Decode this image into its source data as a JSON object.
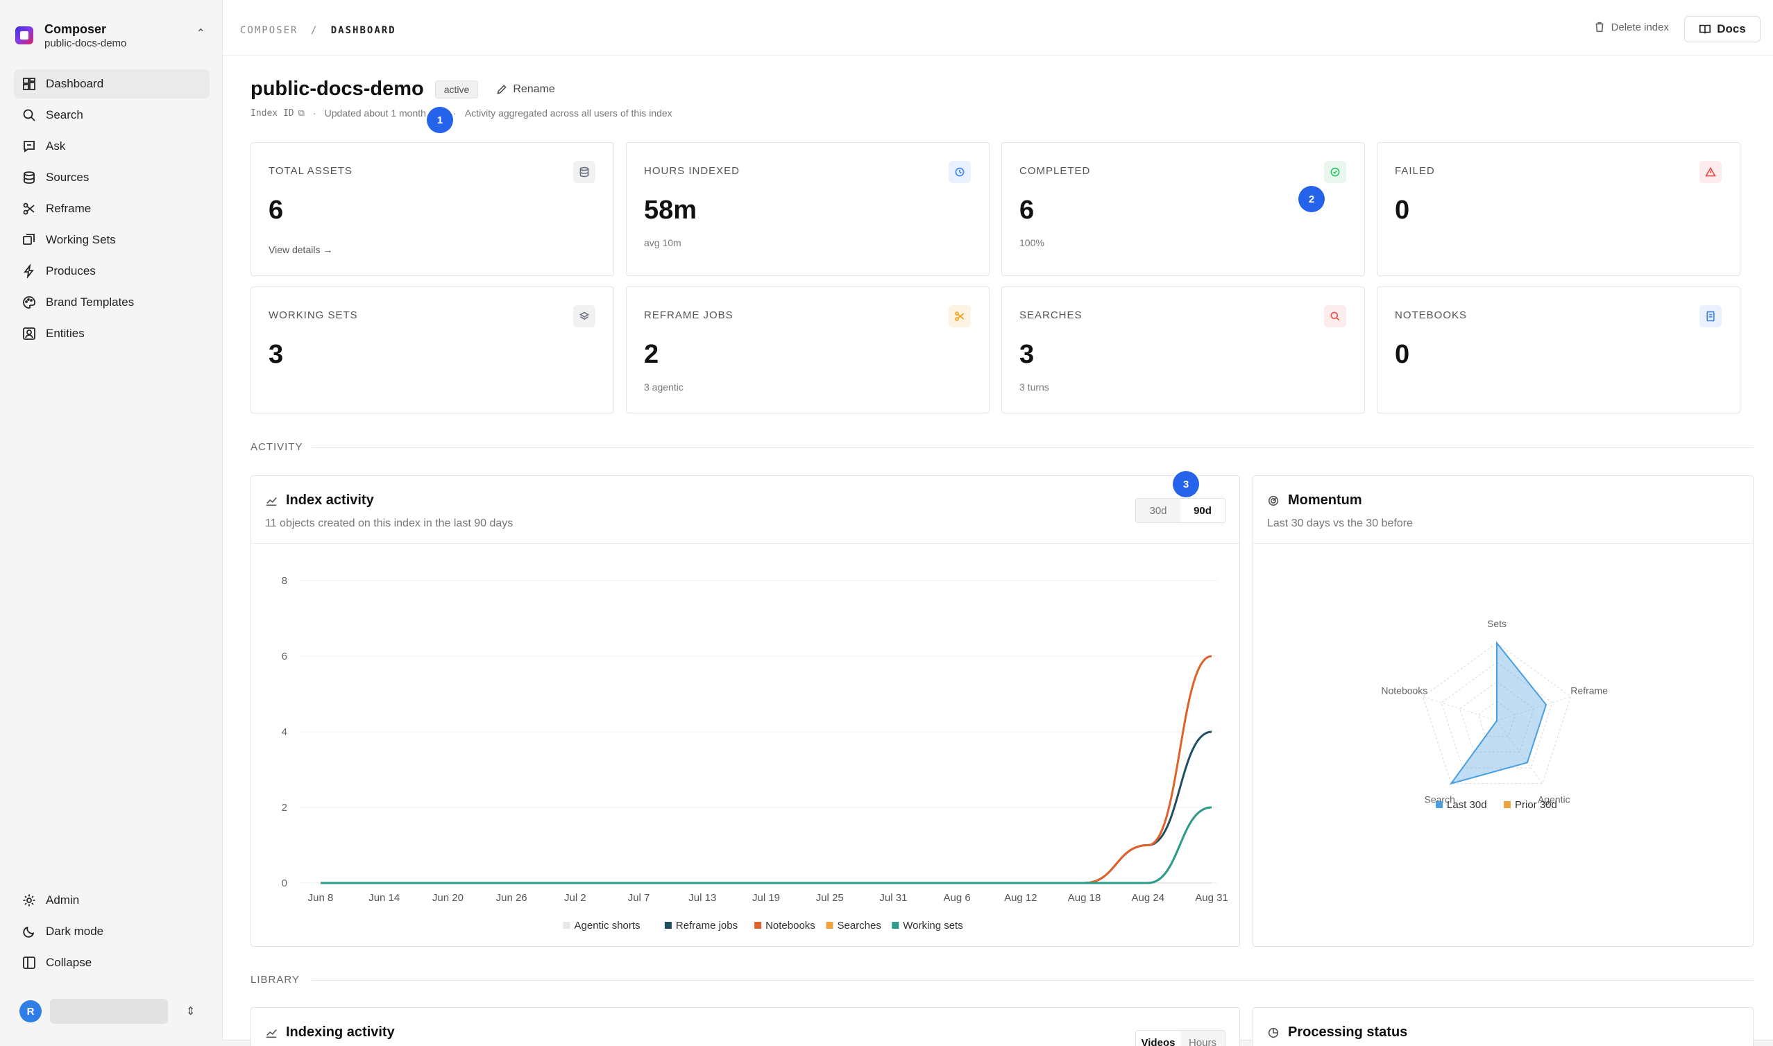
{
  "sidebar": {
    "workspace_name": "Composer",
    "workspace_index": "public-docs-demo",
    "nav": [
      {
        "label": "Dashboard",
        "icon": "dashboard-icon"
      },
      {
        "label": "Search",
        "icon": "search-icon"
      },
      {
        "label": "Ask",
        "icon": "chat-icon"
      },
      {
        "label": "Sources",
        "icon": "database-icon"
      },
      {
        "label": "Reframe",
        "icon": "scissors-icon"
      },
      {
        "label": "Working Sets",
        "icon": "layers-icon"
      },
      {
        "label": "Produces",
        "icon": "bolt-icon"
      },
      {
        "label": "Brand Templates",
        "icon": "palette-icon"
      },
      {
        "label": "Entities",
        "icon": "entity-icon"
      }
    ],
    "bottom": [
      {
        "label": "Admin",
        "icon": "gear-icon"
      },
      {
        "label": "Dark mode",
        "icon": "moon-icon"
      },
      {
        "label": "Collapse",
        "icon": "collapse-icon"
      }
    ],
    "user_initial": "R"
  },
  "topbar": {
    "crumb_root": "COMPOSER",
    "crumb_sep": "/",
    "crumb_current": "DASHBOARD",
    "delete_label": "Delete index",
    "docs_label": "Docs"
  },
  "header": {
    "title": "public-docs-demo",
    "status": "active",
    "rename_label": "Rename",
    "index_id_label": "Index ID",
    "updated": "Updated about 1 month ago",
    "note": "Activity aggregated across all users of this index"
  },
  "markers": [
    "1",
    "2",
    "3"
  ],
  "stats": [
    {
      "label": "TOTAL ASSETS",
      "value": "6",
      "sub": "View details →",
      "icon": "database-icon",
      "color": "#6b7280"
    },
    {
      "label": "HOURS INDEXED",
      "value": "58m",
      "sub": "avg 10m",
      "icon": "clock-icon",
      "color": "#3b82f6"
    },
    {
      "label": "COMPLETED",
      "value": "6",
      "sub": "100%",
      "icon": "check-circle-icon",
      "color": "#22c55e"
    },
    {
      "label": "FAILED",
      "value": "0",
      "sub": "",
      "icon": "warning-icon",
      "color": "#ef4444"
    },
    {
      "label": "WORKING SETS",
      "value": "3",
      "sub": "",
      "icon": "layers-icon",
      "color": "#6b7280"
    },
    {
      "label": "REFRAME JOBS",
      "value": "2",
      "sub": "3 agentic",
      "icon": "scissors-icon",
      "color": "#f59e0b"
    },
    {
      "label": "SEARCHES",
      "value": "3",
      "sub": "3 turns",
      "icon": "search-icon",
      "color": "#ef4444"
    },
    {
      "label": "NOTEBOOKS",
      "value": "0",
      "sub": "",
      "icon": "notebook-icon",
      "color": "#3b82f6"
    }
  ],
  "sections": {
    "activity": "ACTIVITY",
    "library": "LIBRARY"
  },
  "index_activity": {
    "title": "Index activity",
    "subtitle": "11 objects created on this index in the last 90 days",
    "ranges": [
      "30d",
      "90d"
    ],
    "selected_range": "90d"
  },
  "momentum": {
    "title": "Momentum",
    "subtitle": "Last 30 days vs the 30 before"
  },
  "library_cards": {
    "indexing_title": "Indexing activity",
    "indexing_toggle": [
      "Videos",
      "Hours"
    ],
    "processing_title": "Processing status"
  },
  "chart_data": [
    {
      "type": "line",
      "x": [
        "Jun 8",
        "Jun 14",
        "Jun 20",
        "Jun 26",
        "Jul 2",
        "Jul 7",
        "Jul 13",
        "Jul 19",
        "Jul 25",
        "Jul 31",
        "Aug 6",
        "Aug 12",
        "Aug 18",
        "Aug 24",
        "Aug 31"
      ],
      "ylim": [
        0,
        8
      ],
      "yticks": [
        0,
        2,
        4,
        6,
        8
      ],
      "grid": true,
      "legend": "bottom",
      "series": [
        {
          "name": "Agentic shorts",
          "color": "#e5e7eb",
          "values": [
            0,
            0,
            0,
            0,
            0,
            0,
            0,
            0,
            0,
            0,
            0,
            0,
            0,
            0,
            0
          ]
        },
        {
          "name": "Reframe jobs",
          "color": "#1f4e5f",
          "values": [
            0,
            0,
            0,
            0,
            0,
            0,
            0,
            0,
            0,
            0,
            0,
            0,
            0,
            1,
            4
          ]
        },
        {
          "name": "Notebooks",
          "color": "#e0622a",
          "values": [
            0,
            0,
            0,
            0,
            0,
            0,
            0,
            0,
            0,
            0,
            0,
            0,
            0,
            1,
            6
          ]
        },
        {
          "name": "Searches",
          "color": "#f0a23b",
          "values": [
            0,
            0,
            0,
            0,
            0,
            0,
            0,
            0,
            0,
            0,
            0,
            0,
            0,
            0,
            2
          ]
        },
        {
          "name": "Working sets",
          "color": "#2a9d8f",
          "values": [
            0,
            0,
            0,
            0,
            0,
            0,
            0,
            0,
            0,
            0,
            0,
            0,
            0,
            0,
            2
          ]
        }
      ]
    },
    {
      "type": "radar",
      "axes": [
        "Sets",
        "Reframe",
        "Agentic",
        "Search",
        "Notebooks"
      ],
      "rmax": 3,
      "legend": "bottom",
      "series": [
        {
          "name": "Last 30d",
          "color": "#4a9fe0",
          "values": [
            3,
            2,
            2,
            3,
            0
          ]
        },
        {
          "name": "Prior 30d",
          "color": "#f0a23b",
          "values": [
            0,
            0,
            0,
            0,
            0
          ]
        }
      ]
    }
  ]
}
